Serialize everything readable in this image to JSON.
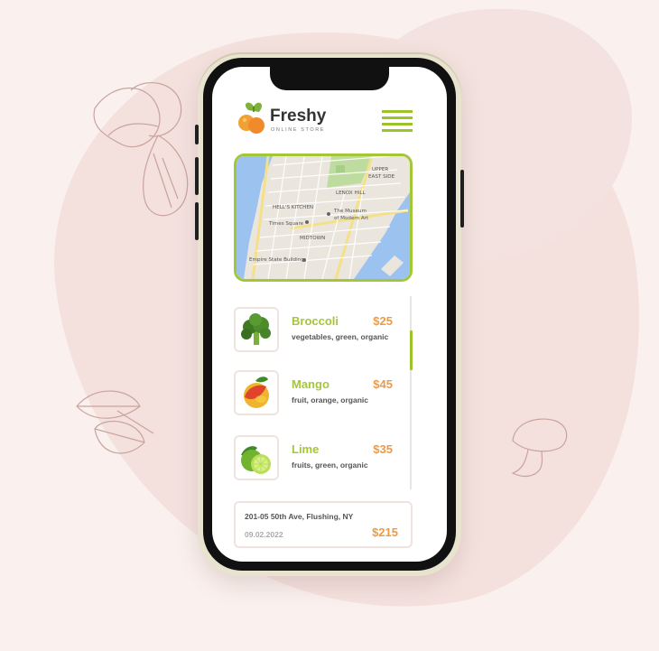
{
  "header": {
    "brand_name": "Freshy",
    "brand_sub": "ONLINE STORE",
    "menu_icon": "hamburger-menu-icon"
  },
  "map": {
    "labels": [
      "UPPER EAST SIDE",
      "LENOX HILL",
      "HELL'S KITCHEN",
      "The Museum of Modern Art",
      "Times Square",
      "MIDTOWN",
      "Empire State Building"
    ]
  },
  "products": [
    {
      "name": "Broccoli",
      "price": "$25",
      "tags": "vegetables, green, organic",
      "icon": "broccoli-icon"
    },
    {
      "name": "Mango",
      "price": "$45",
      "tags": "fruit, orange, organic",
      "icon": "mango-icon"
    },
    {
      "name": "Lime",
      "price": "$35",
      "tags": "fruits, green, organic",
      "icon": "lime-icon"
    }
  ],
  "order": {
    "address": "201-05 50th Ave, Flushing, NY",
    "date": "09.02.2022",
    "total": "$215"
  },
  "colors": {
    "accent_green": "#a4c639",
    "price_orange": "#ef9a42",
    "background": "#faf0ed"
  }
}
